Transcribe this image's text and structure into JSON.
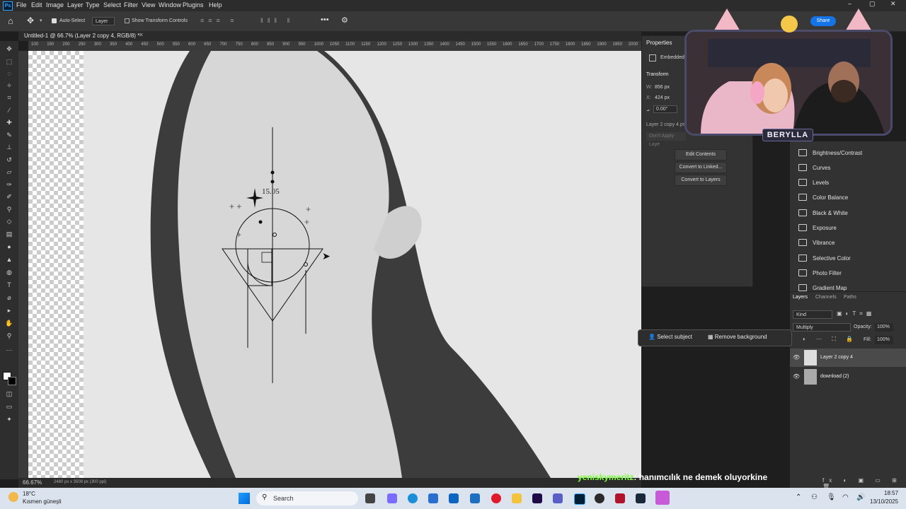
{
  "app": {
    "logo": "Ps"
  },
  "menu": [
    "File",
    "Edit",
    "Image",
    "Layer",
    "Type",
    "Select",
    "Filter",
    "View",
    "Window",
    "Plugins",
    "Help"
  ],
  "options": {
    "auto_select_label": "Auto-Select",
    "layer_select": "Layer",
    "show_transform_label": "Show Transform Controls",
    "share_label": "Share"
  },
  "document": {
    "tab_title": "Untitled-1 @ 66.7% (Layer 2 copy 4, RGB/8) *",
    "zoom": "66.67%",
    "dimensions": "2480 px x 3508 px (300 ppi)"
  },
  "ruler": {
    "ticks": [
      "100",
      "150",
      "200",
      "250",
      "300",
      "350",
      "400",
      "450",
      "500",
      "550",
      "600",
      "650",
      "700",
      "750",
      "800",
      "850",
      "900",
      "950",
      "1000",
      "1050",
      "1100",
      "1150",
      "1200",
      "1250",
      "1300",
      "1350",
      "1400",
      "1450",
      "1500",
      "1550",
      "1600",
      "1650",
      "1700",
      "1750",
      "1800",
      "1850",
      "1900",
      "1950",
      "2000"
    ]
  },
  "tattoo": {
    "date": "15.05"
  },
  "properties": {
    "tab": "Properties",
    "embedded": "Embedded",
    "transform_label": "Transform",
    "w_label": "W:",
    "w_value": "856 px",
    "x_label": "X:",
    "x_value": "424 px",
    "angle_value": "0.00°",
    "layer_ref": "Layer 2 copy 4.ps",
    "dont_apply": "Don't Apply Laye",
    "edit_contents": "Edit Contents",
    "convert_linked": "Convert to Linked...",
    "convert_layers": "Convert to Layers"
  },
  "stream": {
    "name": "BERYLLA"
  },
  "adjustments": [
    "Brightness/Contrast",
    "Curves",
    "Levels",
    "Color Balance",
    "Black & White",
    "Exposure",
    "Vibrance",
    "Selective Color",
    "Photo Filter",
    "Gradient Map"
  ],
  "layers_panel": {
    "tabs": [
      "Layers",
      "Channels",
      "Paths"
    ],
    "kind": "Kind",
    "blend": "Multiply",
    "opacity_label": "Opacity:",
    "opacity": "100%",
    "fill_label": "Fill:",
    "fill": "100%",
    "items": [
      "Layer 2 copy 4",
      "download (2)"
    ]
  },
  "contextbar": {
    "select_subject": "Select subject",
    "remove_background": "Remove background"
  },
  "chat": {
    "user": "yeniskymeritz",
    "message": ": hanımcılık ne demek oluyorkine"
  },
  "taskbar": {
    "temp": "18°C",
    "weather": "Kısmen güneşli",
    "search": "Search",
    "time": "18:57",
    "date": "13/10/2025"
  },
  "colors": {
    "accent": "#31a8ff",
    "chat_user": "#7cff3c"
  }
}
